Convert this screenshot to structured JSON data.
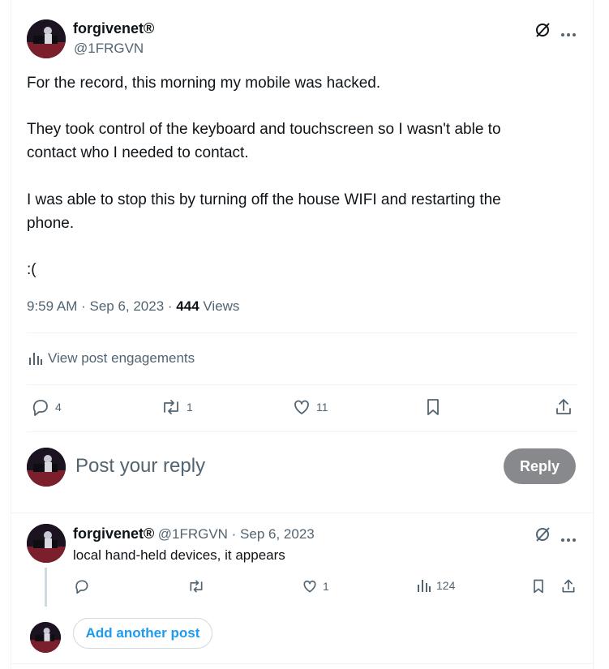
{
  "tweet": {
    "display_name": "forgivenet®",
    "handle": "@1FRGVN",
    "lines": [
      "For the record, this morning my mobile was hacked.",
      "They took control of the keyboard and touchscreen so I wasn't able to",
      "contact who I needed to contact.",
      "I was able to stop this by turning off the house WIFI and restarting the",
      "phone.",
      ":("
    ],
    "time": "9:59 AM · Sep 6, 2023 · ",
    "views_count": "444",
    "views_label": " Views",
    "engagements_label": "View post engagements",
    "replies": "4",
    "reposts": "1",
    "likes": "11"
  },
  "composer": {
    "placeholder": "Post your reply",
    "reply_label": "Reply"
  },
  "reply_tweet": {
    "display_name": "forgivenet®",
    "meta": "@1FRGVN · Sep 6, 2023",
    "text": "local hand-held devices, it appears",
    "likes": "1",
    "views": "124"
  },
  "add_post_label": "Add another post",
  "colors": {
    "accent": "#1d9bf0",
    "muted": "#536471",
    "reply_button": "#87898c"
  },
  "icons": [
    "grok-icon",
    "more-icon",
    "analytics-icon",
    "reply-icon",
    "repost-icon",
    "like-icon",
    "bookmark-icon",
    "share-icon"
  ]
}
